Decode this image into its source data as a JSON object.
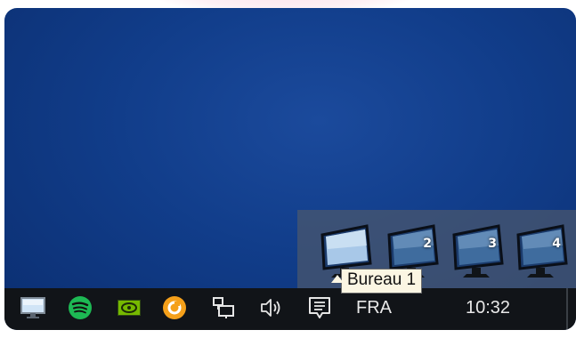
{
  "desktop": {
    "switcher": {
      "desktops": [
        {
          "label": "",
          "active": true
        },
        {
          "label": "2",
          "active": false
        },
        {
          "label": "3",
          "active": false
        },
        {
          "label": "4",
          "active": false
        }
      ],
      "tooltip": "Bureau 1"
    }
  },
  "taskbar": {
    "icons": [
      "virtual-desktop-icon",
      "spotify-icon",
      "nvidia-icon",
      "orange-app-icon",
      "network-icon",
      "volume-icon",
      "notifications-icon"
    ],
    "language": "FRA",
    "clock": "10:32"
  },
  "colors": {
    "desktop_blue": "#113d8a",
    "taskbar": "#111418",
    "spotify": "#1db954",
    "nvidia": "#76b900",
    "orange_app": "#f5a01a"
  }
}
